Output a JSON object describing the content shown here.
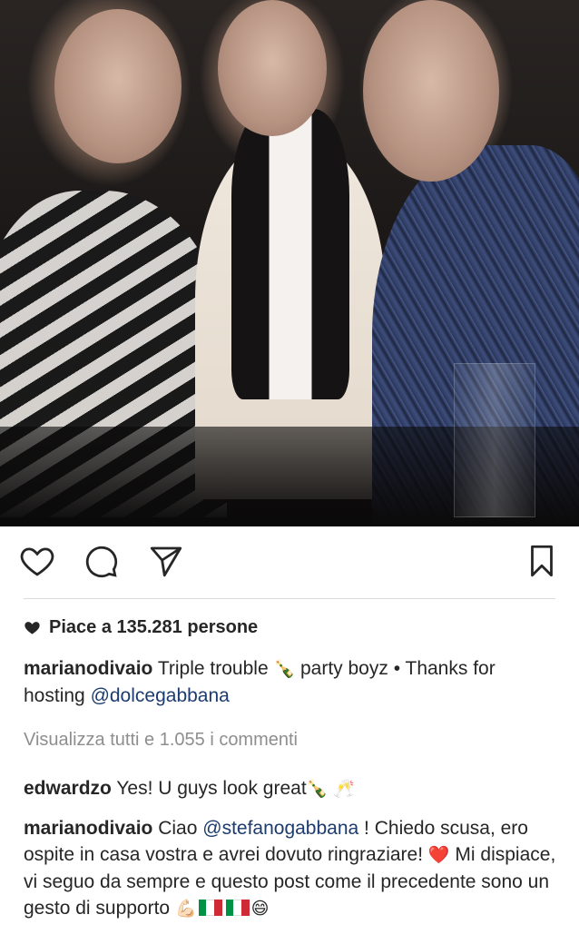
{
  "post": {
    "image_alt": "Three young men celebrating at a party",
    "likes_text": "Piace a 135.281 persone",
    "caption": {
      "username": "marianodivaio",
      "text_before": " Triple trouble ",
      "emoji_1": "🍾",
      "text_after": " party boyz • Thanks for hosting ",
      "mention": "@dolcegabbana"
    },
    "view_all_comments": "Visualizza tutti e 1.055 i commenti",
    "comments": [
      {
        "username": "edwardzo",
        "text": " Yes! U guys look great",
        "emoji": "🍾 🥂"
      },
      {
        "username": "marianodivaio",
        "text_1": " Ciao ",
        "mention": "@stefanogabbana",
        "text_2": " ! Chiedo scusa, ero ospite in casa vostra e avrei dovuto ringraziare! ",
        "heart_emoji": "❤️",
        "text_3": " Mi dispiace, vi seguo da sempre e questo post come il precedente sono un gesto di supporto ",
        "end_emoji": "💪🏻",
        "smile_emoji": "😄"
      }
    ]
  },
  "icons": {
    "like": "heart-outline-icon",
    "comment": "comment-bubble-icon",
    "share": "paper-plane-icon",
    "save": "bookmark-icon",
    "likes_heart": "heart-filled-icon"
  },
  "colors": {
    "text": "#262626",
    "muted": "#8e8e8e",
    "mention": "#1c3b6e",
    "divider": "#dbdbdb",
    "flag_green": "#009246",
    "flag_white": "#ffffff",
    "flag_red": "#ce2b37"
  }
}
